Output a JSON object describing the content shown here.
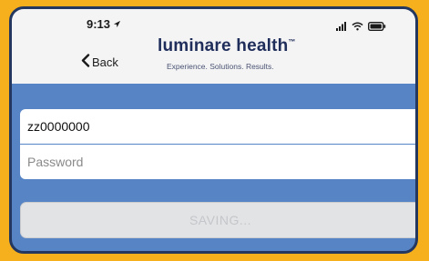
{
  "status_bar": {
    "time": "9:13"
  },
  "nav": {
    "back_label": "Back"
  },
  "brand": {
    "name": "luminare health",
    "tagline": "Experience. Solutions. Results."
  },
  "form": {
    "username_value": "zz0000000",
    "password_placeholder": "Password",
    "password_value": ""
  },
  "button": {
    "label": "SAVING..."
  },
  "colors": {
    "page_background": "#f6b01e",
    "frame_border": "#23375f",
    "form_background": "#5684c4",
    "header_background": "#f4f4f5",
    "brand_text": "#1f2d5a",
    "button_disabled_bg": "#e2e3e5",
    "button_disabled_text": "#c4c6ca"
  },
  "icons": {
    "location": "location-arrow-icon",
    "signal": "signal-bars-icon",
    "wifi": "wifi-icon",
    "battery": "battery-icon",
    "back": "chevron-left-icon"
  }
}
